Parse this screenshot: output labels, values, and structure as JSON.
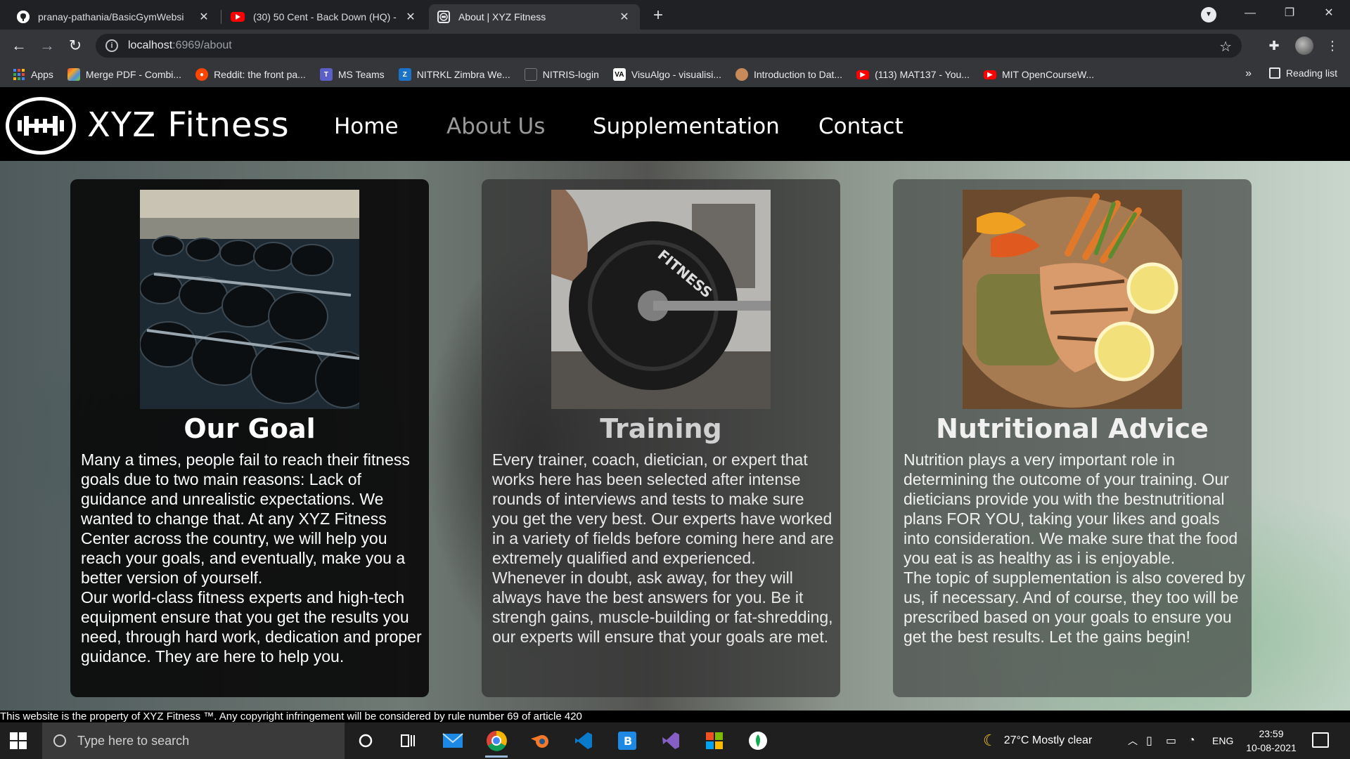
{
  "browser": {
    "tabs": [
      {
        "title": "pranay-pathania/BasicGymWebsi",
        "icon": "github-icon"
      },
      {
        "title": "(30) 50 Cent - Back Down (HQ) -",
        "icon": "youtube-icon"
      },
      {
        "title": "About | XYZ Fitness",
        "icon": "site-logo-icon"
      }
    ],
    "address": {
      "host": "localhost",
      "path": ":6969/about"
    },
    "bookmarks": [
      {
        "label": "Apps",
        "icon": "apps-grid-icon"
      },
      {
        "label": "Merge PDF - Combi...",
        "icon": "pdf-icon"
      },
      {
        "label": "Reddit: the front pa...",
        "icon": "reddit-icon"
      },
      {
        "label": "MS Teams",
        "icon": "teams-icon"
      },
      {
        "label": "NITRKL Zimbra We...",
        "icon": "zimbra-icon"
      },
      {
        "label": "NITRIS-login",
        "icon": "page-icon"
      },
      {
        "label": "VisuAlgo - visualisi...",
        "icon": "visualgo-icon"
      },
      {
        "label": "Introduction to Dat...",
        "icon": "globe-icon"
      },
      {
        "label": "(113) MAT137 - You...",
        "icon": "youtube-icon"
      },
      {
        "label": "MIT OpenCourseW...",
        "icon": "youtube-icon"
      }
    ],
    "bookmarks_more": "»",
    "reading_list": "Reading list"
  },
  "site": {
    "brand": "XYZ Fitness",
    "nav": {
      "home": "Home",
      "about": "About Us",
      "supplementation": "Supplementation",
      "contact": "Contact"
    },
    "cards": [
      {
        "title": "Our Goal",
        "image": "dumbbell-rack-photo",
        "p1": "Many a times, people fail to reach their fitness goals due to two main reasons: Lack of guidance and unrealistic expectations. We wanted to change that. At any XYZ Fitness Center across the country, we will help you reach your goals, and eventually, make you a better version of yourself.",
        "p2": "Our world-class fitness experts and high-tech equipment ensure that you get the results you need, through hard work, dedication and proper guidance. They are here to help you."
      },
      {
        "title": "Training",
        "image": "barbell-plate-photo",
        "p1": "Every trainer, coach, dietician, or expert that works here has been selected after intense rounds of interviews and tests to make sure you get the very best. Our experts have worked in a variety of fields before coming here and are extremely qualified and experienced.",
        "p2": "Whenever in doubt, ask away, for they will always have the best answers for you. Be it strengh gains, muscle-building or fat-shredding, our experts will ensure that your goals are met."
      },
      {
        "title": "Nutritional Advice",
        "image": "salmon-meal-photo",
        "p1": "Nutrition plays a very important role in determining the outcome of your training. Our dieticians provide you with the bestnutritional plans FOR YOU, taking your likes and goals into consideration. We make sure that the food you eat is as healthy as i is enjoyable.",
        "p2": "The topic of supplementation is also covered by us, if necessary. And of course, they too will be prescribed based on your goals to ensure you get the best results. Let the gains begin!"
      }
    ],
    "footer": "This website is the property of XYZ Fitness ™. Any copyright infringement will be considered by rule number 69 of article 420"
  },
  "taskbar": {
    "search_placeholder": "Type here to search",
    "weather": "27°C  Mostly clear",
    "lang": "ENG",
    "time": "23:59",
    "date": "10-08-2021"
  }
}
